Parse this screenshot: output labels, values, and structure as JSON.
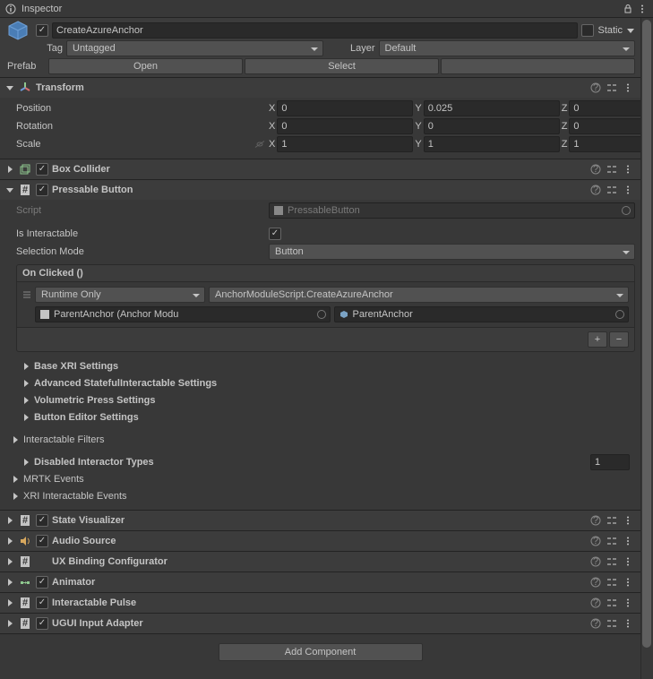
{
  "panel": {
    "title": "Inspector"
  },
  "header": {
    "name": "CreateAzureAnchor",
    "static_label": "Static",
    "tag_label": "Tag",
    "tag_value": "Untagged",
    "layer_label": "Layer",
    "layer_value": "Default",
    "prefab_label": "Prefab",
    "open_btn": "Open",
    "select_btn": "Select"
  },
  "transform": {
    "title": "Transform",
    "position_label": "Position",
    "rotation_label": "Rotation",
    "scale_label": "Scale",
    "pos": {
      "x": "0",
      "y": "0.025",
      "z": "0"
    },
    "rot": {
      "x": "0",
      "y": "0",
      "z": "0"
    },
    "scale": {
      "x": "1",
      "y": "1",
      "z": "1"
    }
  },
  "box_collider": {
    "title": "Box Collider"
  },
  "pressable": {
    "title": "Pressable Button",
    "script_label": "Script",
    "script_value": "PressableButton",
    "interactable_label": "Is Interactable",
    "selection_mode_label": "Selection Mode",
    "selection_mode_value": "Button",
    "event_title": "On Clicked ()",
    "runtime_mode": "Runtime Only",
    "function": "AnchorModuleScript.CreateAzureAnchor",
    "target": "ParentAnchor (Anchor Modu",
    "arg": "ParentAnchor"
  },
  "subsections": {
    "base_xri": "Base XRI Settings",
    "advanced": "Advanced StatefulInteractable Settings",
    "volumetric": "Volumetric Press Settings",
    "button_editor": "Button Editor Settings",
    "interactable_filters": "Interactable Filters",
    "disabled_types": "Disabled Interactor Types",
    "disabled_types_count": "1",
    "mrtk_events": "MRTK Events",
    "xri_events": "XRI Interactable Events"
  },
  "components": {
    "state_visualizer": "State Visualizer",
    "audio_source": "Audio Source",
    "ux_binding": "UX Binding Configurator",
    "animator": "Animator",
    "interactable_pulse": "Interactable Pulse",
    "ugui_input": "UGUI Input Adapter"
  },
  "footer": {
    "add_component": "Add Component"
  },
  "labels": {
    "x": "X",
    "y": "Y",
    "z": "Z"
  }
}
